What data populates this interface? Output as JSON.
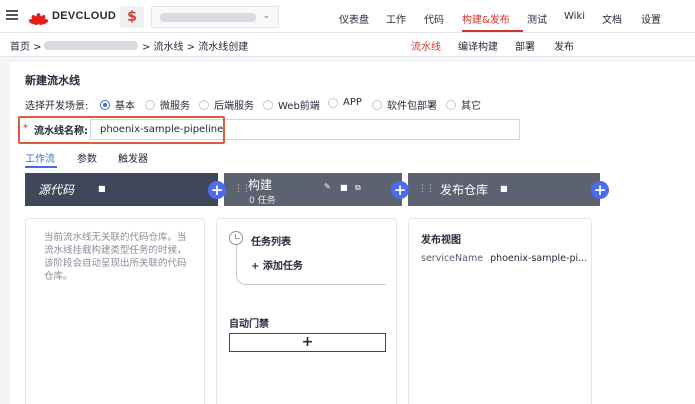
{
  "app": {
    "brand": "DEVCLOUD",
    "project_icon": "$"
  },
  "topnav": {
    "items": [
      "仪表盘",
      "工作",
      "代码",
      "构建&发布",
      "测试",
      "Wiki",
      "文档",
      "设置"
    ],
    "active": "构建&发布"
  },
  "breadcrumb": {
    "home": "首页 >",
    "pipeline": "> 流水线 > 流水线创建"
  },
  "subnav": {
    "items": [
      "流水线",
      "编译构建",
      "部署",
      "发布"
    ],
    "active": "流水线"
  },
  "page": {
    "title": "新建流水线",
    "scene_label": "选择开发场景:",
    "scenes": [
      "基本",
      "微服务",
      "后端服务",
      "Web前端",
      "APP",
      "软件包部署",
      "其它"
    ],
    "selected_scene": "基本",
    "name_required_mark": "*",
    "name_label": "流水线名称:",
    "name_value": "phoenix-sample-pipeline"
  },
  "tabs": {
    "items": [
      "工作流",
      "参数",
      "触发器"
    ],
    "active": "工作流"
  },
  "stages": [
    {
      "title": "源代码",
      "hint": "当前流水线无关联的代码仓库。当流水线挂载构建类型任务的时候，该阶段会自动呈现出所关联的代码仓库。"
    },
    {
      "title": "构建",
      "subtitle": "0 任务",
      "task_list_label": "任务列表",
      "add_task_label": "+ 添加任务",
      "gate_label": "自动门禁",
      "gate_button": "+"
    },
    {
      "title": "发布仓库",
      "view_title": "发布视图",
      "service_key": "serviceName",
      "service_value": "phoenix-sample-pi..."
    }
  ],
  "colors": {
    "accent_red": "#d0362f",
    "accent_blue": "#3f6ee8",
    "highlight_box": "#e05a43",
    "stage_dark": "#41475a",
    "stage_gray": "#5d6270"
  },
  "icons": {
    "menu": "hamburger-icon",
    "trash": "trash-icon",
    "edit": "pencil-icon",
    "copy": "copy-icon",
    "add": "plus-icon",
    "drag": "drag-handle-icon",
    "clock": "clock-icon"
  }
}
